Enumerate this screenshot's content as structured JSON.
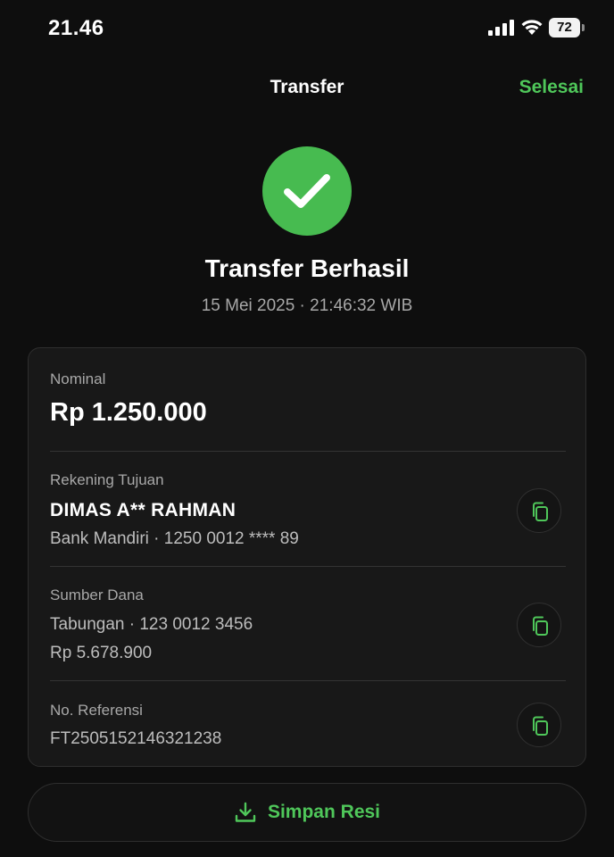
{
  "status_bar": {
    "time": "21.46",
    "battery": "72"
  },
  "header": {
    "title": "Transfer",
    "done_label": "Selesai"
  },
  "result": {
    "title": "Transfer Berhasil",
    "datetime": "15 Mei 2025 · 21:46:32 WIB"
  },
  "details": {
    "nominal": {
      "label": "Nominal",
      "value": "Rp 1.250.000"
    },
    "destination": {
      "label": "Rekening Tujuan",
      "name": "DIMAS A** RAHMAN",
      "account": "Bank Mandiri · 1250 0012 **** 89"
    },
    "source": {
      "label": "Sumber Dana",
      "account": "Tabungan · 123 0012 3456",
      "balance": "Rp 5.678.900"
    },
    "reference": {
      "label": "No. Referensi",
      "value": "FT2505152146321238"
    }
  },
  "actions": {
    "save_label": "Simpan Resi"
  },
  "colors": {
    "accent": "#4fc75a",
    "success_circle": "#47bb50",
    "background": "#0e0e0e",
    "card": "#181818"
  },
  "icons": [
    "signal-icon",
    "wifi-icon",
    "battery-icon",
    "checkmark-icon",
    "copy-icon",
    "download-icon"
  ]
}
